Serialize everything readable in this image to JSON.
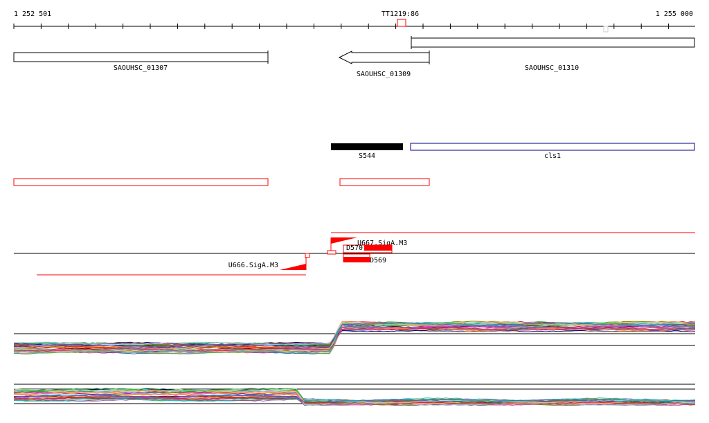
{
  "ruler": {
    "start_label": "1 252 501",
    "end_label": "1 255 000",
    "marker_label": "TT1219:86"
  },
  "genes": [
    {
      "id": "gene-saouhsc-01307",
      "label": "SAOUHSC_01307"
    },
    {
      "id": "gene-saouhsc-01309",
      "label": "SAOUHSC_01309"
    },
    {
      "id": "gene-saouhsc-01310",
      "label": "SAOUHSC_01310"
    }
  ],
  "features": [
    {
      "id": "feature-s544",
      "label": "S544"
    },
    {
      "id": "feature-cls1",
      "label": "cls1"
    }
  ],
  "promoters": [
    {
      "id": "u667",
      "label": "U667.SigA.M3"
    },
    {
      "id": "u666",
      "label": "U666.SigA.M3"
    }
  ],
  "segments": [
    {
      "id": "d570",
      "label": "D570"
    },
    {
      "id": "d569",
      "label": "D569"
    }
  ],
  "colors": {
    "axis": "#000000",
    "feature_red": "#ff0000",
    "cls1_blue": "#000080",
    "s544_fill": "#000000"
  },
  "expression_panels": 2
}
